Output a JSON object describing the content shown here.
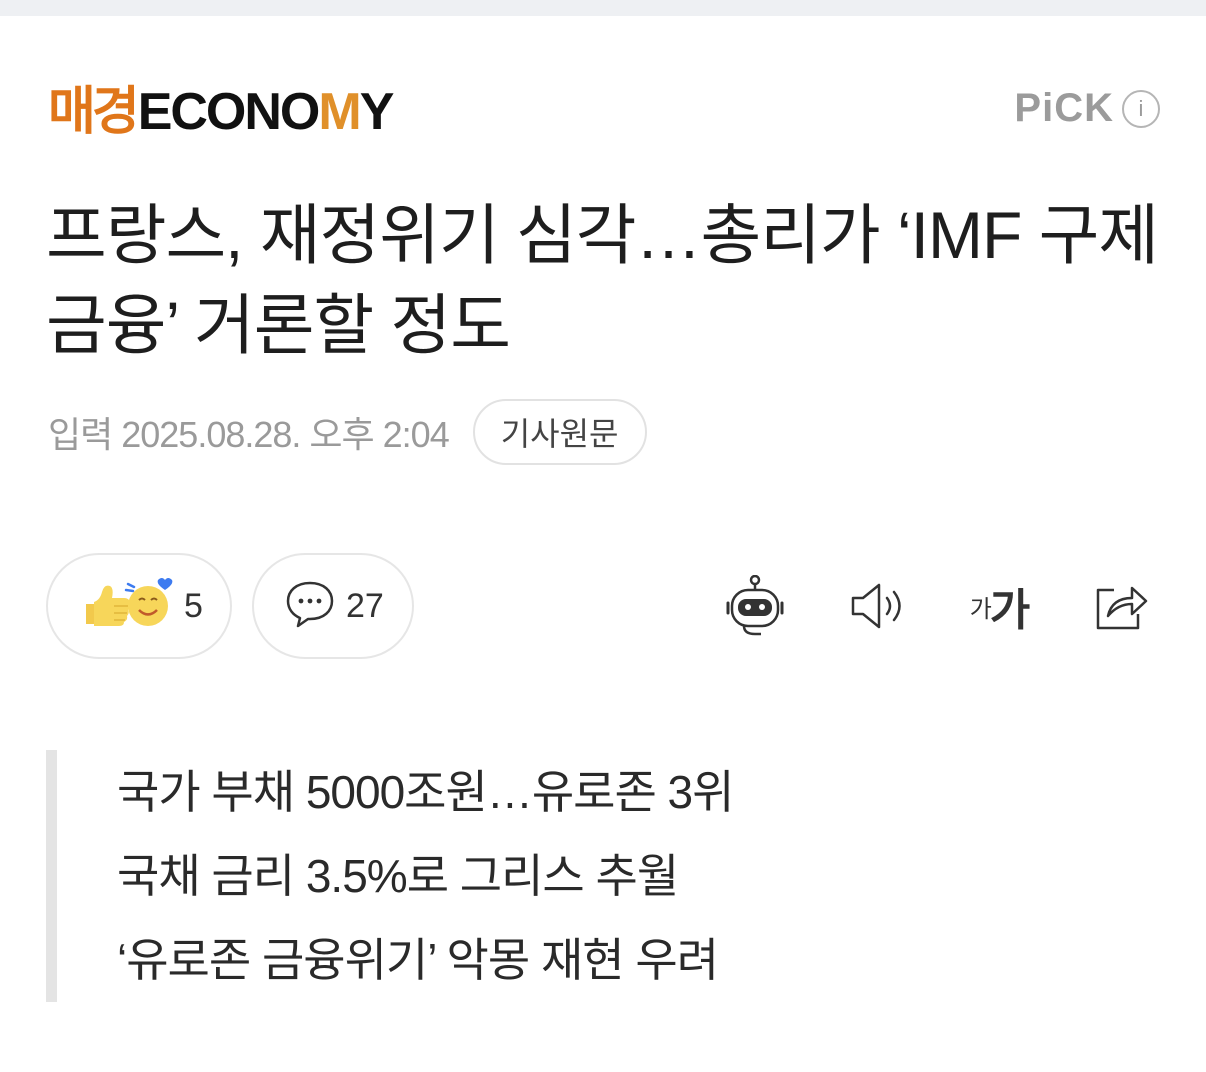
{
  "header": {
    "logo_kr": "매경",
    "logo_en_part1": "ECONO",
    "logo_en_m": "M",
    "logo_en_part2": "Y",
    "pick_label": "PiCK",
    "info_label": "i"
  },
  "article": {
    "headline": "프랑스, 재정위기 심각…총리가 ‘IMF 구제금융’ 거론할 정도",
    "date": "입력 2025.08.28. 오후 2:04",
    "original_button": "기사원문"
  },
  "actions": {
    "reaction_count": "5",
    "comment_count": "27",
    "fontsize_small": "가",
    "fontsize_large": "가"
  },
  "summary": {
    "lines": [
      "국가 부채 5000조원…유로존 3위",
      "국채 금리 3.5%로 그리스 추월",
      "‘유로존 금융위기’ 악몽 재현 우려"
    ]
  },
  "icons": {
    "reaction": "thumbs-up-smile-icon",
    "comment": "speech-bubble-icon",
    "summary_bot": "robot-icon",
    "audio": "speaker-icon",
    "fontsize": "font-size-icon",
    "share": "share-icon"
  },
  "colors": {
    "logo_orange": "#e0761a",
    "logo_m": "#e0902a",
    "muted": "#9a9a9a"
  }
}
